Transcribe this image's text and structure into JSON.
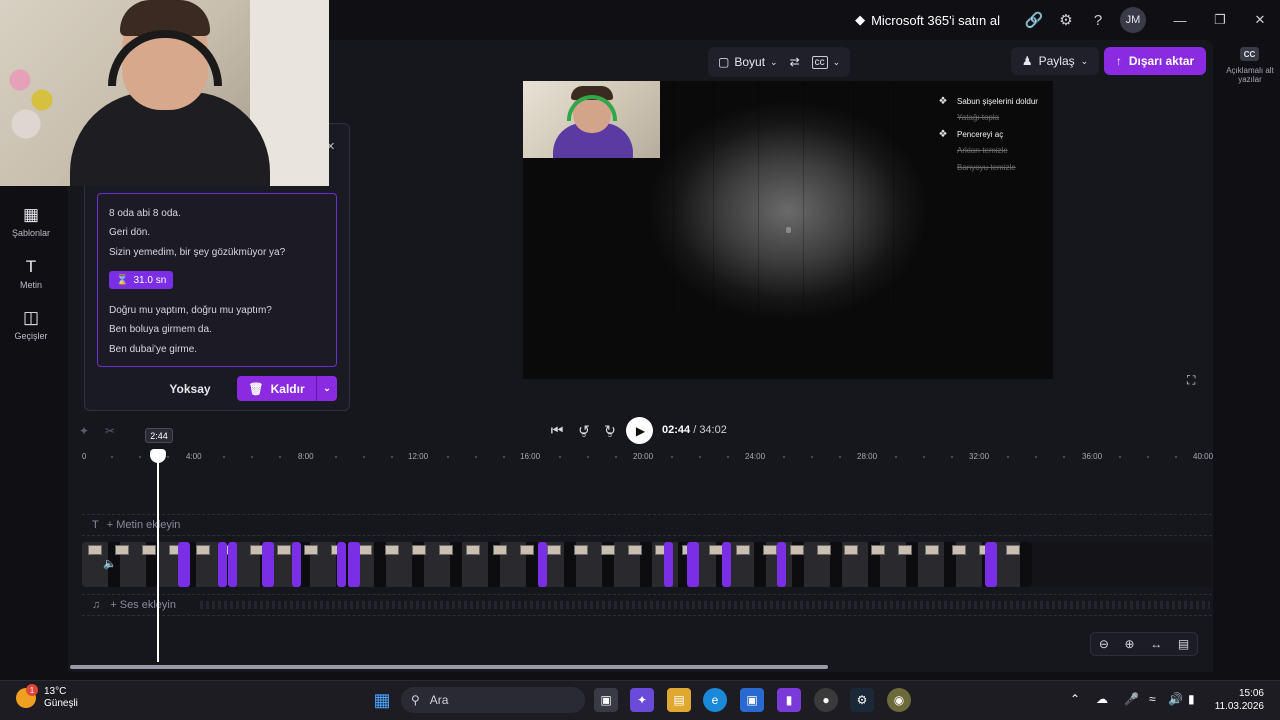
{
  "titlebar": {
    "ms365": "Microsoft 365'i satın al",
    "avatar": "JM"
  },
  "rail": [
    {
      "label": "Şablonlar",
      "icon": "templates-icon"
    },
    {
      "label": "Metin",
      "icon": "text-icon"
    },
    {
      "label": "Geçişler",
      "icon": "transitions-icon"
    }
  ],
  "right_rail": {
    "cc": "CC",
    "label": "Açıklamalı alt yazılar"
  },
  "toolbar": {
    "size_label": "Boyut",
    "share_label": "Paylaş",
    "export_label": "Dışarı aktar"
  },
  "popup": {
    "lines_before": [
      "8 oda abi 8 oda.",
      "Geri dön.",
      "Sizin yemedim, bir şey gözükmüyor ya?"
    ],
    "pause": "31.0 sn",
    "lines_after": [
      "Doğru mu yaptım, doğru mu yaptım?",
      "Ben boluya girmem da.",
      "Ben dubai'ye girme."
    ],
    "ignore_label": "Yoksay",
    "remove_label": "Kaldır"
  },
  "preview": {
    "tasks": [
      {
        "text": "Sabun şişelerini doldur",
        "done": false
      },
      {
        "text": "Yatağı topla",
        "done": true
      },
      {
        "text": "Pencereyi aç",
        "done": false
      },
      {
        "text": "Arkları temizle",
        "done": true
      },
      {
        "text": "Banyoyu temizle",
        "done": true
      }
    ]
  },
  "playback": {
    "current": "02:44",
    "total": "/ 34:02",
    "skip_back": "5",
    "skip_fwd": "5"
  },
  "timeline": {
    "playhead_label": "2:44",
    "ticks": [
      "0",
      "4:00",
      "8:00",
      "12:00",
      "16:00",
      "20:00",
      "24:00",
      "28:00",
      "32:00",
      "36:00",
      "40:00"
    ],
    "add_text": "+ Metin ekleyin",
    "add_audio": "+ Ses ekleyin"
  },
  "taskbar": {
    "temp": "13°C",
    "weather": "Güneşli",
    "badge": "1",
    "search": "Ara",
    "time": "15:06",
    "date": "11.03.2026"
  }
}
